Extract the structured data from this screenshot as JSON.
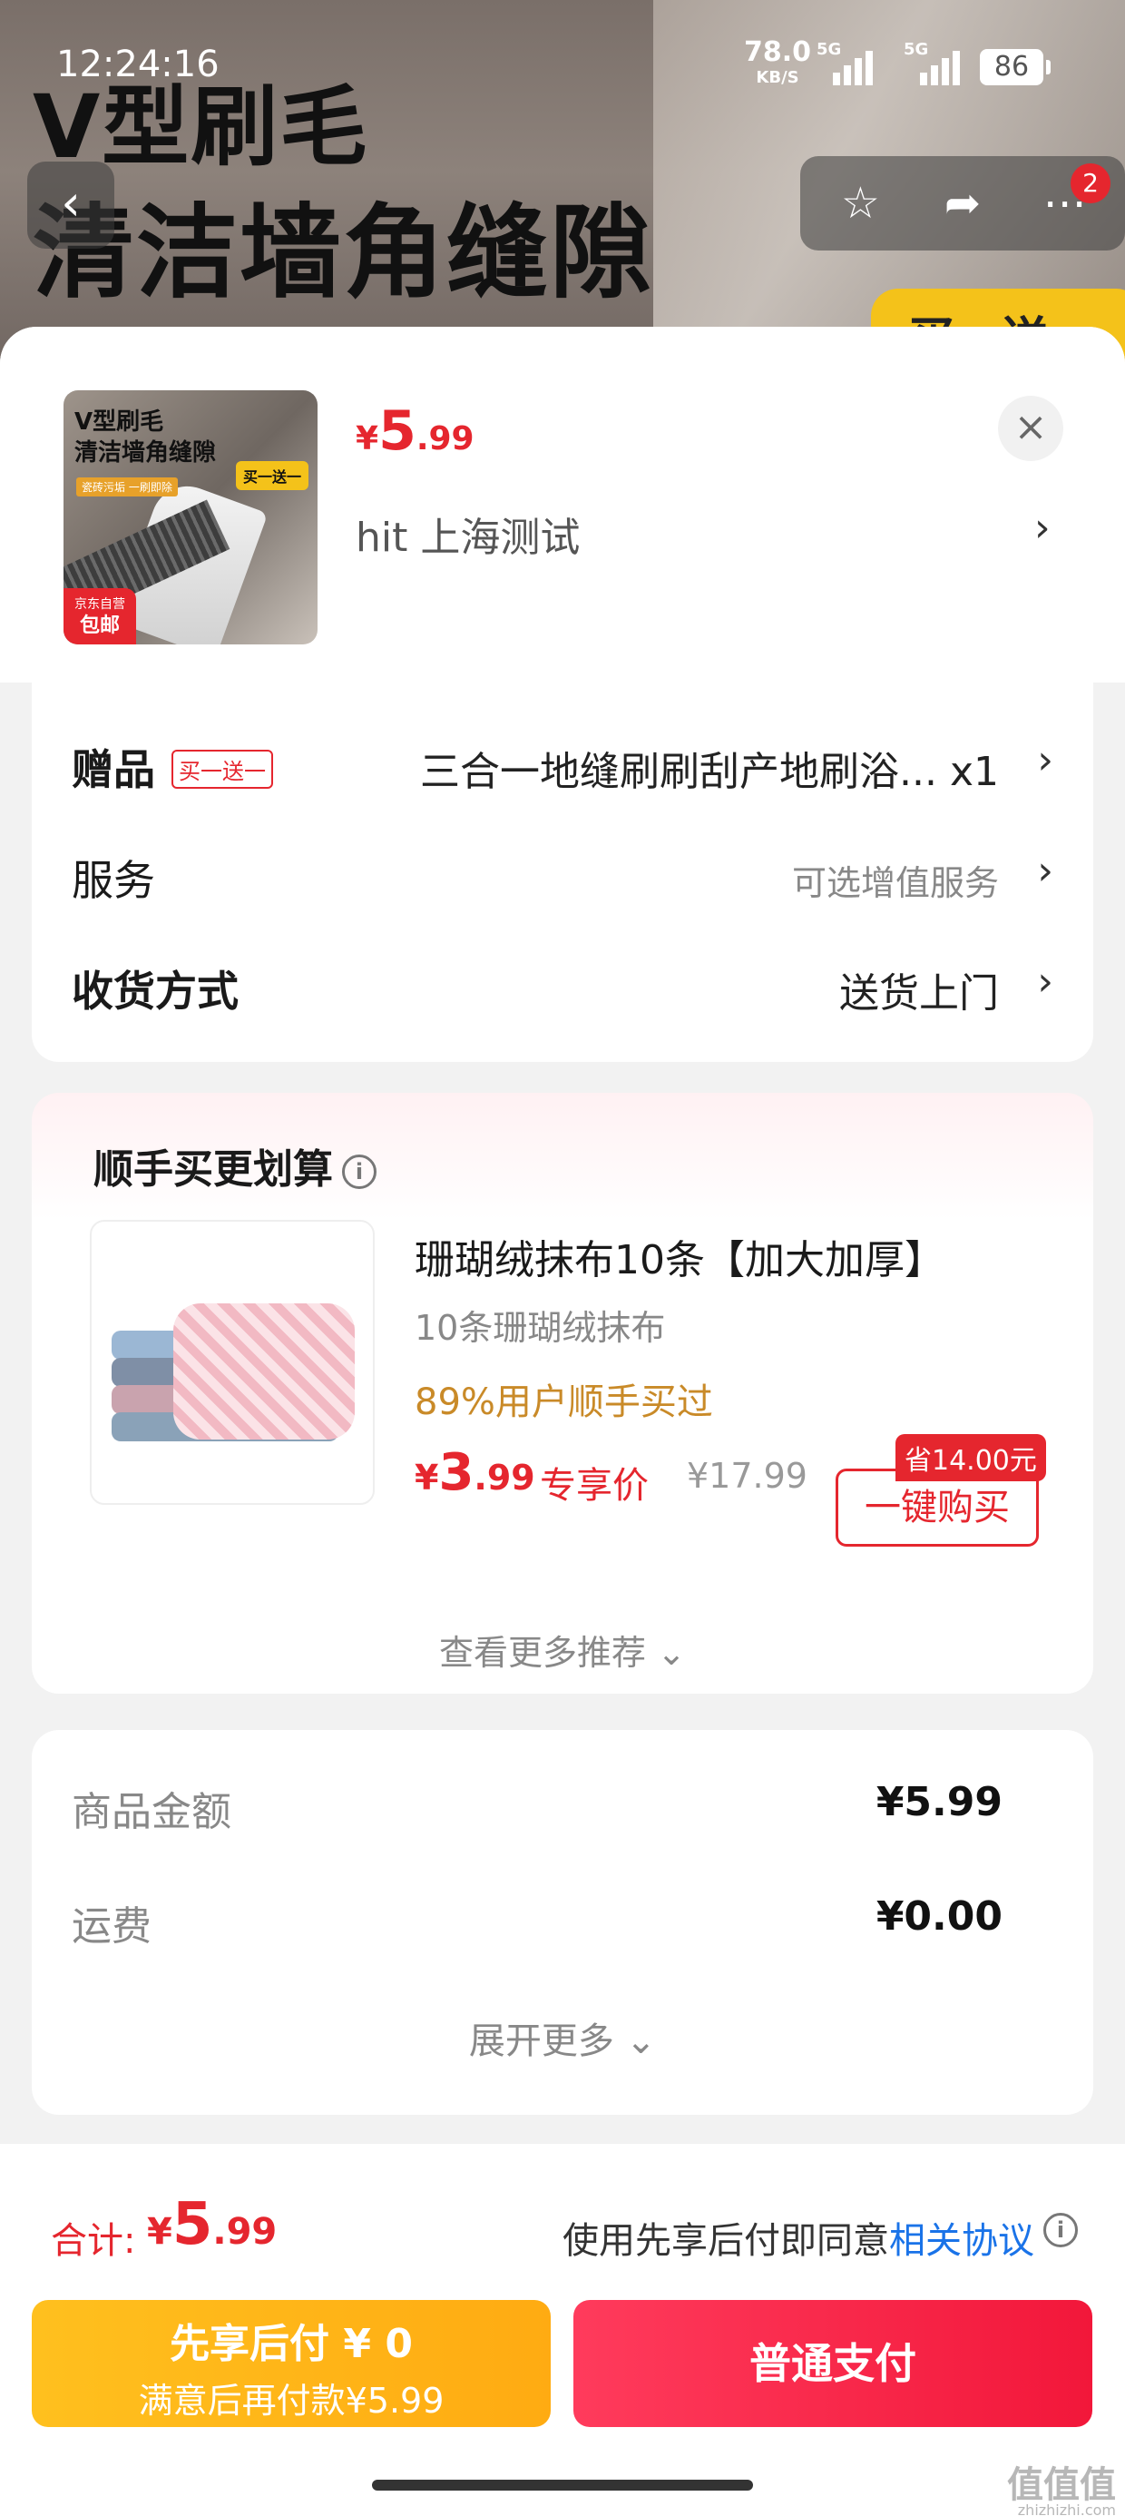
{
  "status_bar": {
    "time": "12:24:16",
    "net_speed": "78.0",
    "net_unit": "KB/S",
    "signal1": "5G",
    "signal2": "5G",
    "battery": "86"
  },
  "backdrop": {
    "headline1": "V型刷毛",
    "headline2": "清洁墙角缝隙",
    "promo": "买一送一",
    "back_icon": "back-arrow-icon",
    "actions": [
      "star-icon",
      "share-icon",
      "more-icon"
    ],
    "badge": "2"
  },
  "product": {
    "thumb_line1": "V型刷毛",
    "thumb_line2": "清洁墙角缝隙",
    "thumb_tag": "瓷砖污垢 一刷即除",
    "thumb_buy": "买一送一",
    "thumb_jd1": "京东自营",
    "thumb_jd2": "包邮",
    "price_currency": "¥",
    "price_int": "5",
    "price_dec": ".99",
    "address": "hit  上海测试",
    "arrow": "›",
    "close": "×"
  },
  "options": {
    "gift_label": "赠品",
    "gift_tag": "买一送一",
    "gift_value": "三合一地缝刷刷刮产地刷浴... x1",
    "service_label": "服务",
    "service_value": "可选增值服务",
    "delivery_label": "收货方式",
    "delivery_value": "送货上门"
  },
  "recommend": {
    "title": "顺手买更划算",
    "product_name": "珊瑚绒抹布10条【加大加厚】",
    "spec": "10条珊瑚绒抹布",
    "sold": "89%用户顺手买过",
    "price_currency": "¥",
    "price_int": "3",
    "price_dec": ".99",
    "exclusive": "专享价",
    "original_price": "¥17.99",
    "save": "省14.00元",
    "buy_button": "一键购买",
    "more": "查看更多推荐 ⌄"
  },
  "summary": {
    "goods_label": "商品金额",
    "goods_value": "¥5.99",
    "freight_label": "运费",
    "freight_value": "¥0.00",
    "more": "展开更多 ⌄"
  },
  "bottom": {
    "total_label": "合计:",
    "total_currency": "¥",
    "total_int": "5",
    "total_dec": ".99",
    "agree_text": "使用先享后付即同意",
    "agree_link": "相关协议",
    "later_line1": "先享后付 ¥ 0",
    "later_line2": "满意后再付款¥5.99",
    "pay_button": "普通支付",
    "watermark": "值值值",
    "watermark_sub": "zhizhizhi.com"
  },
  "colors": {
    "accent_red": "#e5262e",
    "pay_gradient": "#ff3b5c",
    "later_gradient": "#ffc01e",
    "link_blue": "#1a73e8",
    "sold_orange": "#c98a28"
  }
}
